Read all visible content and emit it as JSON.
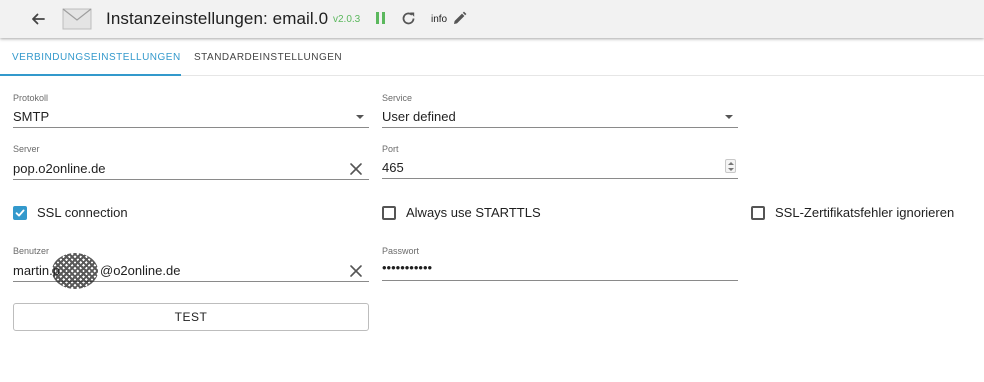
{
  "header": {
    "title": "Instanzeinstellungen: email.0",
    "version": "v2.0.3",
    "info_label": "info"
  },
  "tabs": [
    {
      "label": "VERBINDUNGSEINSTELLUNGEN",
      "active": true
    },
    {
      "label": "STANDARDEINSTELLUNGEN",
      "active": false
    }
  ],
  "form": {
    "protocol": {
      "label": "Protokoll",
      "value": "SMTP"
    },
    "service": {
      "label": "Service",
      "value": "User defined"
    },
    "server": {
      "label": "Server",
      "value": "pop.o2online.de"
    },
    "port": {
      "label": "Port",
      "value": "465"
    },
    "ssl": {
      "label": "SSL connection",
      "checked": true
    },
    "starttls": {
      "label": "Always use STARTTLS",
      "checked": false
    },
    "ssl_ignore": {
      "label": "SSL-Zertifikatsfehler ignorieren",
      "checked": false
    },
    "user": {
      "label": "Benutzer",
      "value_prefix": "martin.p",
      "value_suffix": "@o2online.de"
    },
    "password": {
      "label": "Passwort",
      "value": "•••••••••••"
    },
    "test_button": "TEST"
  },
  "colors": {
    "accent": "#3399cc",
    "version_green": "#5bb85d",
    "topbar_bg": "#f2f2f2"
  },
  "icons": [
    "back-arrow-icon",
    "envelope-icon",
    "pause-icon",
    "reload-icon",
    "pencil-icon",
    "close-icon",
    "check-icon"
  ]
}
